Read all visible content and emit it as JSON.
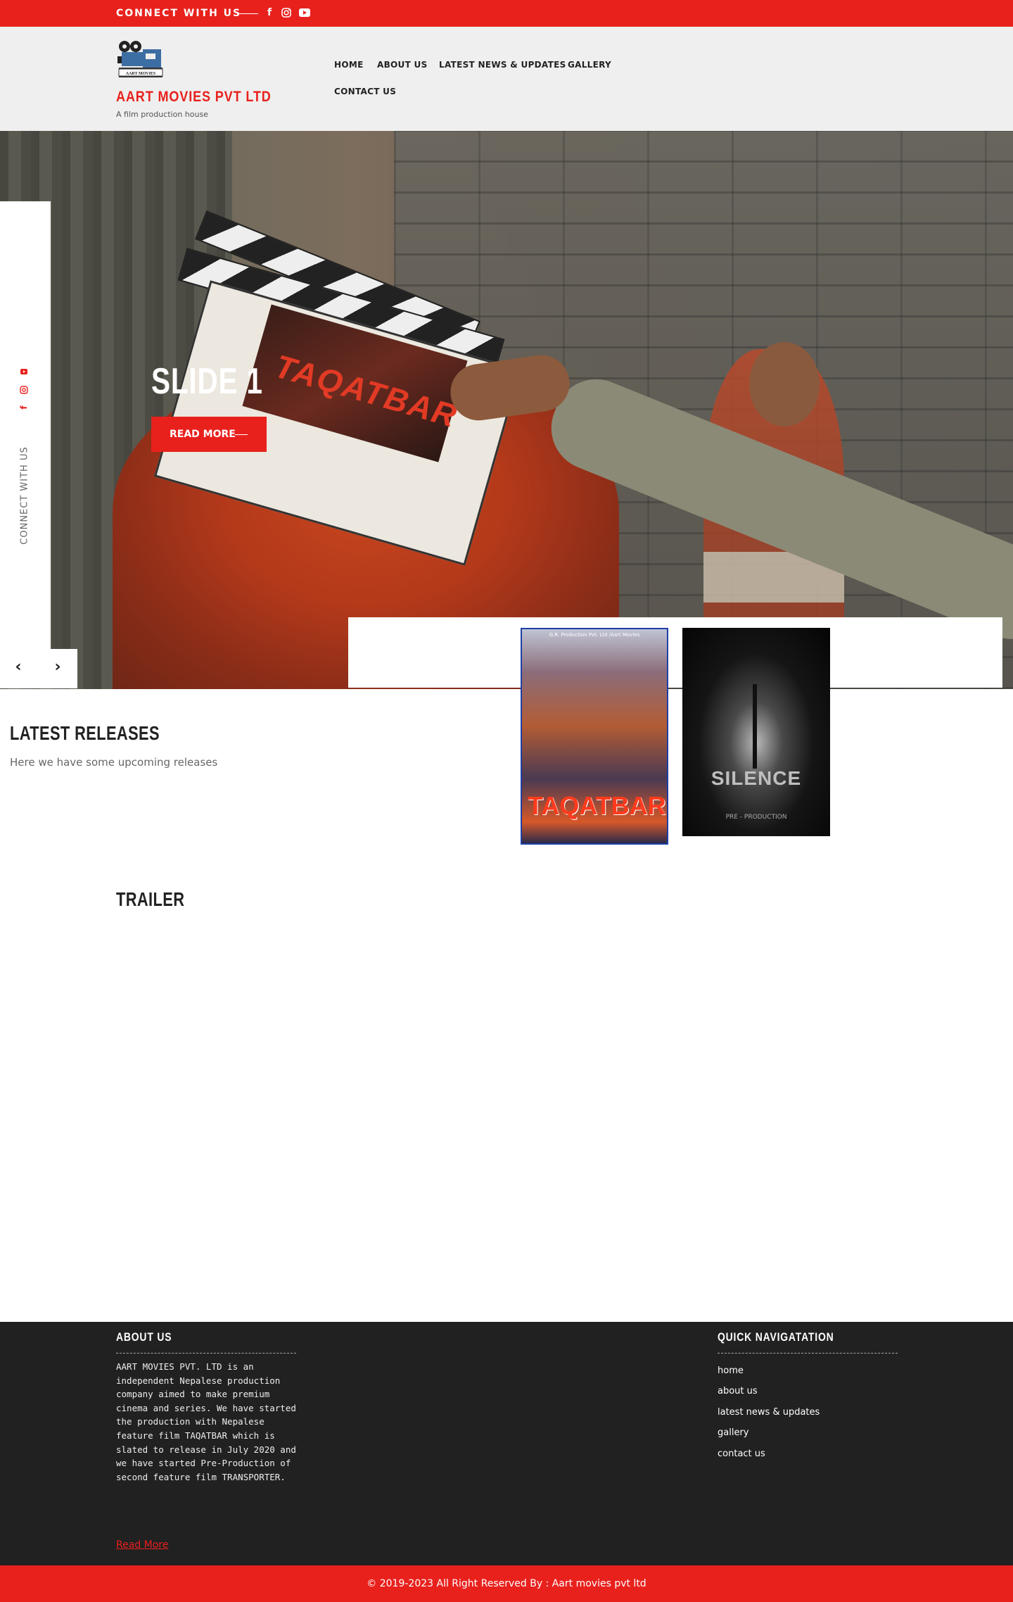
{
  "topbar": {
    "connect_label": "CONNECT WITH US",
    "icons": [
      "facebook-icon",
      "instagram-icon",
      "youtube-icon"
    ]
  },
  "header": {
    "logo_text": "AART MOVIES",
    "brand": "AART MOVIES PVT LTD",
    "tagline": "A film production house",
    "nav": [
      "HOME",
      "ABOUT US",
      "LATEST NEWS & UPDATES",
      "GALLERY",
      "CONTACT US"
    ]
  },
  "hero": {
    "clapper_title": "TAQATBAR",
    "slide_title": "SLIDE 1",
    "read_more": "READ MORE",
    "side_connect": "CONNECT WITH US",
    "prev": "‹",
    "next": "›"
  },
  "releases": {
    "title": "LATEST RELEASES",
    "subtitle": "Here we have some upcoming releases",
    "posters": [
      {
        "title": "TAQATBAR",
        "top_text": "G.R. Production Pvt. Ltd /Aart Movies"
      },
      {
        "title": "SILENCE",
        "status": "PRE - PRODUCTION"
      }
    ]
  },
  "trailer": {
    "title": "TRAILER"
  },
  "footer": {
    "about_title": "ABOUT US",
    "about_text": "AART MOVIES PVT. LTD is an independent Nepalese production company aimed to make premium cinema and series. We have started the production with Nepalese feature film TAQATBAR which is slated to release in July 2020 and we have started Pre-Production of second feature film TRANSPORTER.",
    "read_more": "Read More",
    "nav_title": "QUICK NAVIGATATION",
    "nav_links": [
      "home",
      "about us",
      "latest news & updates",
      "gallery",
      "contact us"
    ],
    "copyright": "© 2019-2023 All Right Reserved By : Aart movies pvt ltd"
  },
  "colors": {
    "accent": "#e8211d",
    "footer_bg": "#212121",
    "header_bg": "#efefef"
  }
}
